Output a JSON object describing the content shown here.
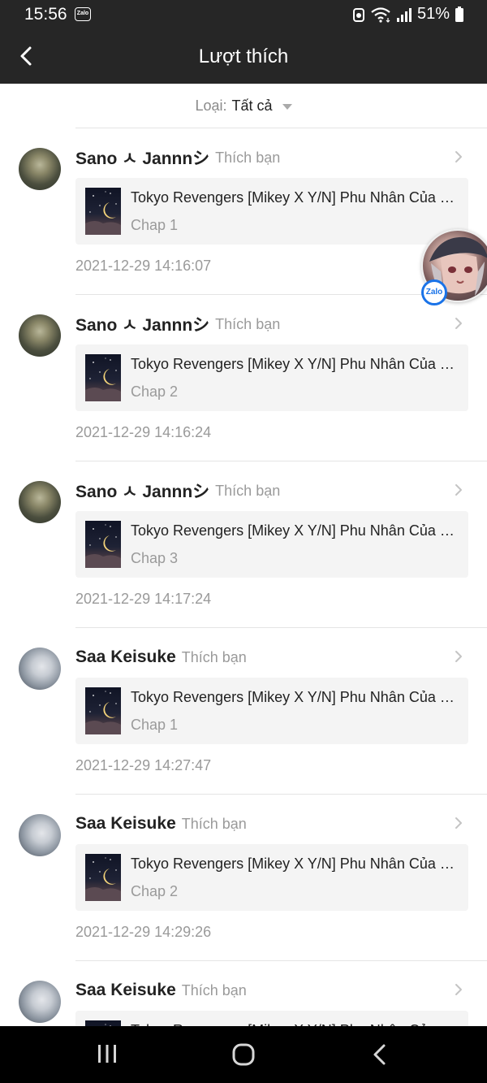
{
  "status_bar": {
    "time": "15:56",
    "notification_app": "Zalo",
    "battery_percent": "51%",
    "icons": [
      "recycle-icon",
      "wifi-icon",
      "signal-icon",
      "battery-icon"
    ]
  },
  "header": {
    "title": "Lượt thích",
    "back_icon": "chevron-left-icon"
  },
  "filter": {
    "label": "Loại:",
    "value": "Tất cả"
  },
  "items": [
    {
      "user": "Sano ㅅ Jannnシ",
      "action": "Thích bạn",
      "story": "Tokyo Revengers [Mikey X Y/N] Phu Nhân Của Mikey",
      "chapter": "Chap 1",
      "time": "2021-12-29 14:16:07"
    },
    {
      "user": "Sano ㅅ Jannnシ",
      "action": "Thích bạn",
      "story": "Tokyo Revengers [Mikey X Y/N] Phu Nhân Của Mikey",
      "chapter": "Chap 2",
      "time": "2021-12-29 14:16:24"
    },
    {
      "user": "Sano ㅅ Jannnシ",
      "action": "Thích bạn",
      "story": "Tokyo Revengers [Mikey X Y/N] Phu Nhân Của Mikey",
      "chapter": "Chap 3",
      "time": "2021-12-29 14:17:24"
    },
    {
      "user": "Saa Keisuke",
      "action": "Thích bạn",
      "story": "Tokyo Revengers [Mikey X Y/N] Phu Nhân Của Mikey",
      "chapter": "Chap 1",
      "time": "2021-12-29 14:27:47"
    },
    {
      "user": "Saa Keisuke",
      "action": "Thích bạn",
      "story": "Tokyo Revengers [Mikey X Y/N] Phu Nhân Của Mikey",
      "chapter": "Chap 2",
      "time": "2021-12-29 14:29:26"
    },
    {
      "user": "Saa Keisuke",
      "action": "Thích bạn",
      "story": "Tokyo Revengers [Mikey X Y/N] Phu Nhân Của Mikey",
      "chapter": "",
      "time": ""
    }
  ],
  "floating_chat": {
    "badge": "Zalo"
  },
  "nav_bar": {
    "icons": [
      "recent-apps-icon",
      "home-icon",
      "back-icon"
    ]
  },
  "colors": {
    "header_bg": "#262626",
    "card_bg": "#f4f4f4",
    "muted_text": "#9a9a9a",
    "zalo_blue": "#1a73e8"
  }
}
